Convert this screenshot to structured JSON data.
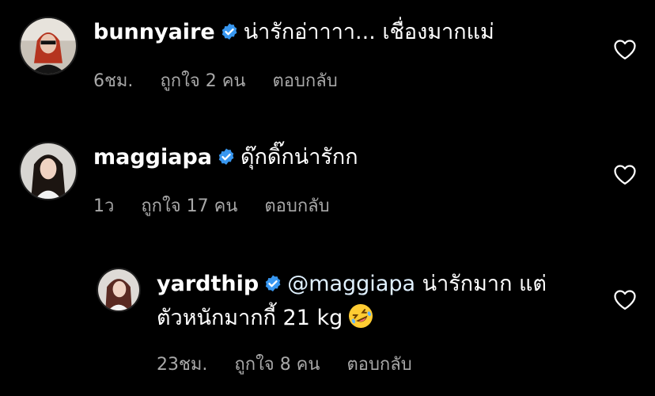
{
  "comments": [
    {
      "username": "bunnyaire",
      "text": "น่ารักอ่าาาา... เชื่องมากแม่",
      "time": "6ชม.",
      "likes": "ถูกใจ 2 คน",
      "reply": "ตอบกลับ"
    },
    {
      "username": "maggiapa",
      "text": "ดุ๊กดิ๊กน่ารักก",
      "time": "1ว",
      "likes": "ถูกใจ 17 คน",
      "reply": "ตอบกลับ"
    }
  ],
  "reply": {
    "username": "yardthip",
    "mention": "@maggiapa",
    "text_line1": "น่ารักมาก แต่",
    "text_line2": "ตัวหนักมากกี้ 21 kg",
    "emoji": "rolling-on-floor-laughing-emoji",
    "time": "23ชม.",
    "likes": "ถูกใจ 8 คน",
    "reply_label": "ตอบกลับ"
  },
  "colors": {
    "background": "#000000",
    "text": "#ffffff",
    "meta": "#a8a8a8",
    "verified": "#3897f0",
    "mention": "#e0f1ff"
  }
}
